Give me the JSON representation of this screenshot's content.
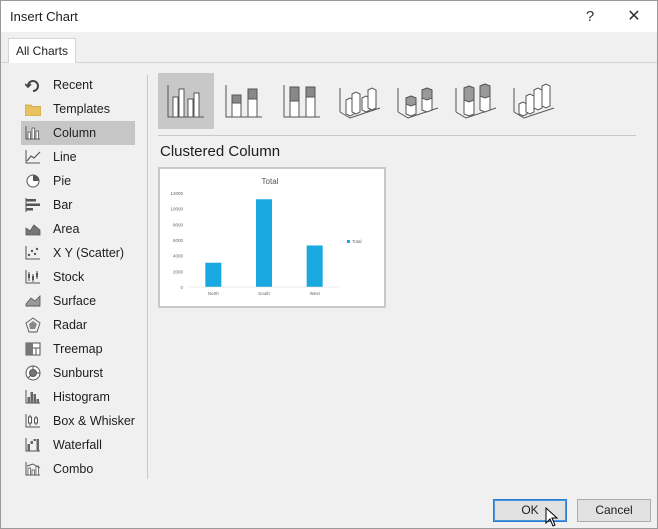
{
  "window": {
    "title": "Insert Chart",
    "help_label": "?",
    "close_label": "✕"
  },
  "tabs": [
    {
      "label": "All Charts"
    }
  ],
  "sidebar": {
    "items": [
      {
        "label": "Recent",
        "icon": "recent-icon"
      },
      {
        "label": "Templates",
        "icon": "folder-icon"
      },
      {
        "label": "Column",
        "icon": "column-chart-icon",
        "selected": true
      },
      {
        "label": "Line",
        "icon": "line-chart-icon"
      },
      {
        "label": "Pie",
        "icon": "pie-chart-icon"
      },
      {
        "label": "Bar",
        "icon": "bar-chart-icon"
      },
      {
        "label": "Area",
        "icon": "area-chart-icon"
      },
      {
        "label": "X Y (Scatter)",
        "icon": "scatter-chart-icon"
      },
      {
        "label": "Stock",
        "icon": "stock-chart-icon"
      },
      {
        "label": "Surface",
        "icon": "surface-chart-icon"
      },
      {
        "label": "Radar",
        "icon": "radar-chart-icon"
      },
      {
        "label": "Treemap",
        "icon": "treemap-chart-icon"
      },
      {
        "label": "Sunburst",
        "icon": "sunburst-chart-icon"
      },
      {
        "label": "Histogram",
        "icon": "histogram-chart-icon"
      },
      {
        "label": "Box & Whisker",
        "icon": "box-whisker-chart-icon"
      },
      {
        "label": "Waterfall",
        "icon": "waterfall-chart-icon"
      },
      {
        "label": "Combo",
        "icon": "combo-chart-icon"
      }
    ]
  },
  "main": {
    "subtypes": [
      "clustered-column-icon",
      "stacked-column-icon",
      "100-stacked-column-icon",
      "3d-clustered-column-icon",
      "3d-stacked-column-icon",
      "3d-100-stacked-column-icon",
      "3d-column-icon"
    ],
    "selected_subtype_title": "Clustered Column"
  },
  "preview": {
    "chart_data": {
      "type": "bar",
      "title": "Total",
      "categories": [
        "North",
        "South",
        "West"
      ],
      "series": [
        {
          "name": "Total",
          "values": [
            3100,
            11200,
            5300
          ]
        }
      ],
      "ylim": [
        0,
        12000
      ],
      "yticks": [
        "12000",
        "10000",
        "8000",
        "6000",
        "4000",
        "2000",
        "0"
      ],
      "grid": false,
      "legend": "right",
      "color": "#1aa9e0"
    }
  },
  "footer": {
    "ok_label": "OK",
    "cancel_label": "Cancel"
  },
  "colors": {
    "accent": "#2a7bd4",
    "selected_bg": "#c6c6c6",
    "panel_bg": "#f0f0f0"
  }
}
